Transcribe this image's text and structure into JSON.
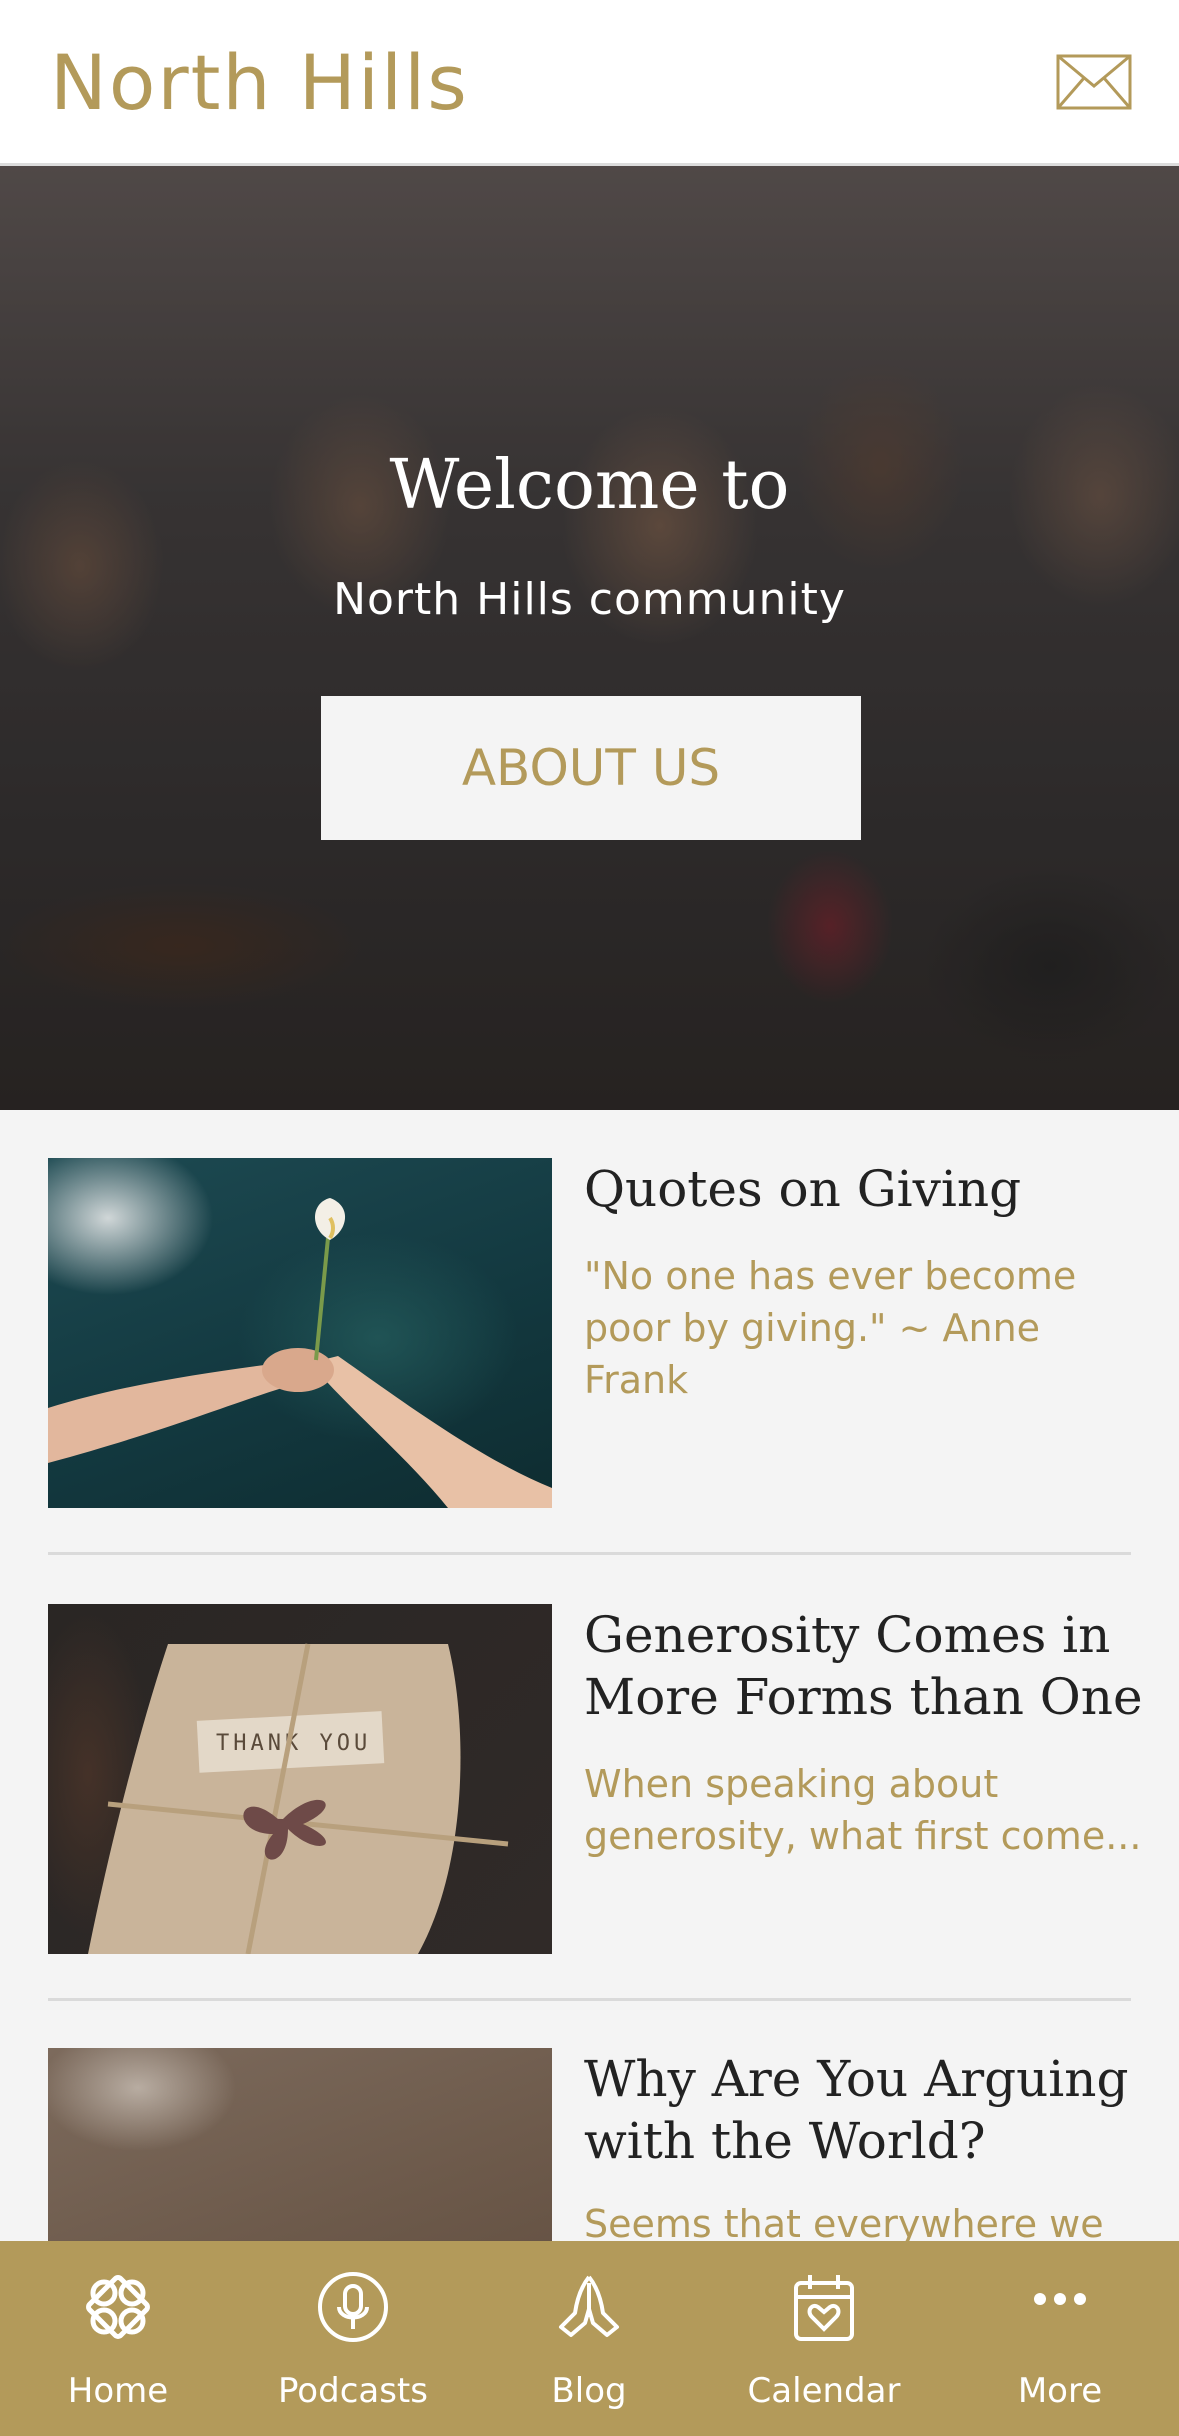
{
  "header": {
    "title": "North Hills",
    "mail_icon": "envelope-icon"
  },
  "hero": {
    "title": "Welcome to",
    "subtitle": "North Hills community",
    "button_label": "ABOUT US"
  },
  "feed": [
    {
      "title": "Quotes on Giving",
      "excerpt": "\"No one has ever become poor by giving.\" ~ Anne Frank",
      "image": "hands-giving-flower"
    },
    {
      "title": "Generosity Comes in More Forms than One",
      "excerpt": "When speaking about generosity, what first come...",
      "image": "thank-you-gift"
    },
    {
      "title": "Why Are You Arguing with the World?",
      "excerpt": "Seems that everywhere we",
      "image": "animal-fur"
    }
  ],
  "tabbar": [
    {
      "label": "Home",
      "icon": "celtic-knot-icon"
    },
    {
      "label": "Podcasts",
      "icon": "microphone-icon"
    },
    {
      "label": "Blog",
      "icon": "praying-hands-icon"
    },
    {
      "label": "Calendar",
      "icon": "calendar-heart-icon"
    },
    {
      "label": "More",
      "icon": "more-dots-icon"
    }
  ],
  "colors": {
    "accent": "#b39a5a",
    "background": "#f4f4f4",
    "header": "#ffffff"
  }
}
